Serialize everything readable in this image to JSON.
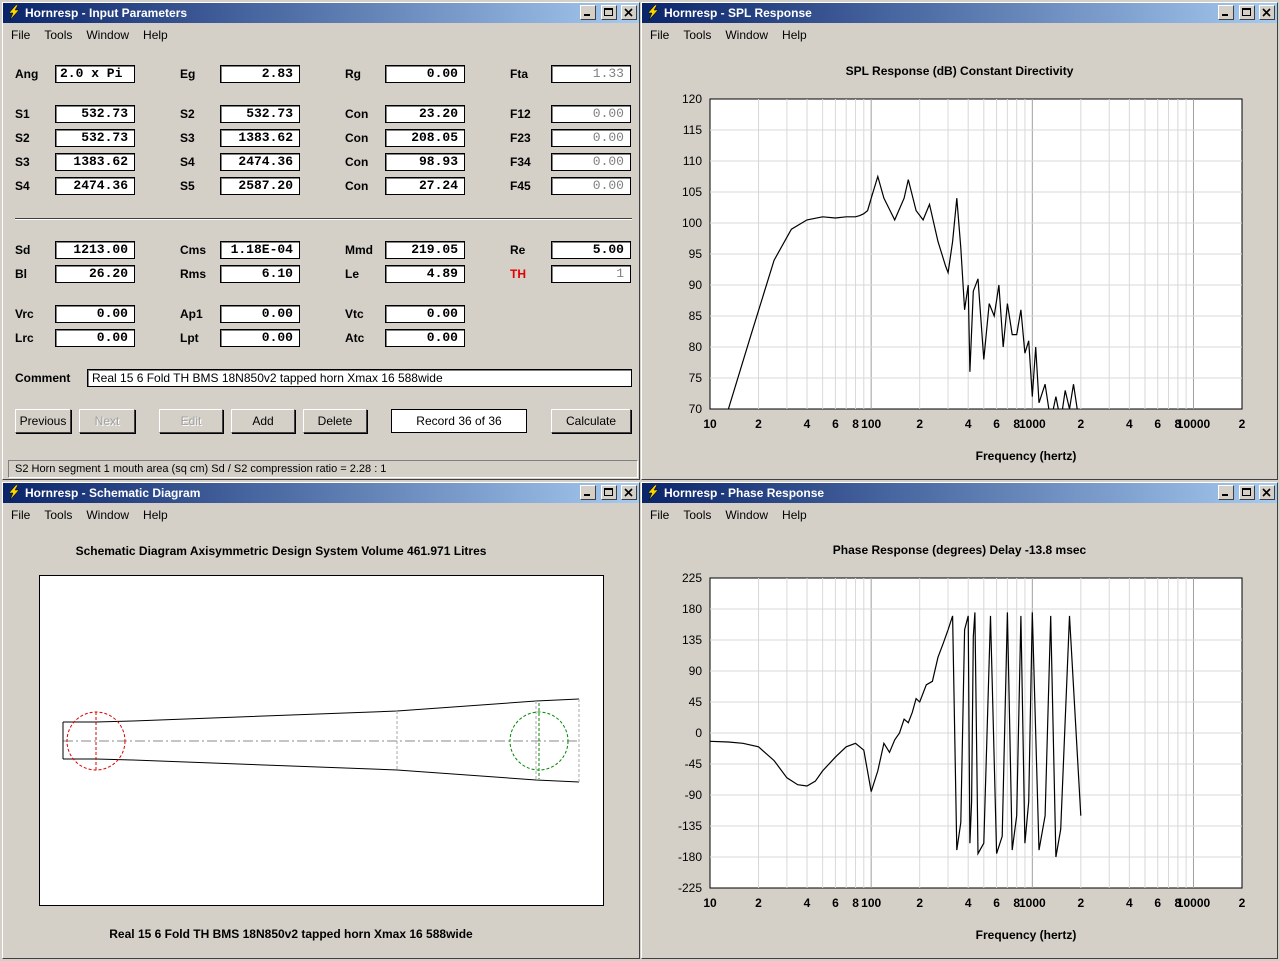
{
  "windows": {
    "input": {
      "title": "Hornresp - Input Parameters",
      "menu": [
        "File",
        "Tools",
        "Window",
        "Help"
      ],
      "rows1": [
        [
          {
            "l": "Ang",
            "v": "2.0 x Pi",
            "left": true
          },
          {
            "l": "Eg",
            "v": "2.83"
          },
          {
            "l": "Rg",
            "v": "0.00"
          },
          {
            "l": "Fta",
            "v": "1.33",
            "gray": true
          }
        ],
        [
          {
            "l": "S1",
            "v": "532.73"
          },
          {
            "l": "S2",
            "v": "532.73"
          },
          {
            "l": "Con",
            "v": "23.20"
          },
          {
            "l": "F12",
            "v": "0.00",
            "gray": true
          }
        ],
        [
          {
            "l": "S2",
            "v": "532.73"
          },
          {
            "l": "S3",
            "v": "1383.62"
          },
          {
            "l": "Con",
            "v": "208.05"
          },
          {
            "l": "F23",
            "v": "0.00",
            "gray": true
          }
        ],
        [
          {
            "l": "S3",
            "v": "1383.62"
          },
          {
            "l": "S4",
            "v": "2474.36"
          },
          {
            "l": "Con",
            "v": "98.93"
          },
          {
            "l": "F34",
            "v": "0.00",
            "gray": true
          }
        ],
        [
          {
            "l": "S4",
            "v": "2474.36"
          },
          {
            "l": "S5",
            "v": "2587.20"
          },
          {
            "l": "Con",
            "v": "27.24"
          },
          {
            "l": "F45",
            "v": "0.00",
            "gray": true
          }
        ]
      ],
      "rows2": [
        [
          {
            "l": "Sd",
            "v": "1213.00"
          },
          {
            "l": "Cms",
            "v": "1.18E-04"
          },
          {
            "l": "Mmd",
            "v": "219.05"
          },
          {
            "l": "Re",
            "v": "5.00"
          }
        ],
        [
          {
            "l": "Bl",
            "v": "26.20"
          },
          {
            "l": "Rms",
            "v": "6.10"
          },
          {
            "l": "Le",
            "v": "4.89"
          },
          {
            "l": "TH",
            "v": "1",
            "gray": true,
            "red": true
          }
        ],
        [
          {
            "l": "Vrc",
            "v": "0.00"
          },
          {
            "l": "Ap1",
            "v": "0.00"
          },
          {
            "l": "Vtc",
            "v": "0.00"
          }
        ],
        [
          {
            "l": "Lrc",
            "v": "0.00"
          },
          {
            "l": "Lpt",
            "v": "0.00"
          },
          {
            "l": "Atc",
            "v": "0.00"
          }
        ]
      ],
      "comment_label": "Comment",
      "comment": "Real 15 6 Fold TH BMS 18N850v2 tapped horn  Xmax 16 588wide",
      "buttons": {
        "previous": "Previous",
        "next": "Next",
        "edit": "Edit",
        "add": "Add",
        "delete": "Delete",
        "record": "Record 36 of 36",
        "calculate": "Calculate"
      },
      "status": "S2   Horn segment 1 mouth area  (sq cm)   Sd / S2 compression ratio = 2.28 : 1"
    },
    "spl": {
      "title": "Hornresp - SPL Response",
      "menu": [
        "File",
        "Tools",
        "Window",
        "Help"
      ],
      "chart_title": "SPL Response (dB)    Constant Directivity"
    },
    "schematic": {
      "title": "Hornresp - Schematic Diagram",
      "menu": [
        "File",
        "Tools",
        "Window",
        "Help"
      ],
      "heading": "Schematic Diagram    Axisymmetric Design    System Volume 461.971 Litres",
      "caption": "Real 15 6 Fold TH BMS 18N850v2 tapped horn  Xmax 16 588wide"
    },
    "phase": {
      "title": "Hornresp - Phase Response",
      "menu": [
        "File",
        "Tools",
        "Window",
        "Help"
      ],
      "chart_title": "Phase Response (degrees)    Delay -13.8 msec"
    }
  },
  "chart_data": [
    {
      "type": "line",
      "xscale": "log",
      "xlabel": "Frequency (hertz)",
      "ylabel": "",
      "ylim": [
        70,
        120
      ],
      "yticks": [
        70,
        75,
        80,
        85,
        90,
        95,
        100,
        105,
        110,
        115,
        120
      ],
      "xlim": [
        10,
        20000
      ],
      "xtick_labels": [
        "10",
        "2",
        "4",
        "6",
        "8",
        "100",
        "2",
        "4",
        "6",
        "8",
        "1000",
        "2",
        "4",
        "6",
        "8",
        "10000",
        "2"
      ],
      "series": [
        {
          "x": [
            10,
            13,
            18,
            25,
            32,
            40,
            50,
            60,
            70,
            80,
            85,
            90,
            95,
            100,
            110,
            120,
            140,
            160,
            170,
            190,
            210,
            230,
            260,
            290,
            300,
            320,
            340,
            360,
            380,
            400,
            410,
            430,
            460,
            500,
            540,
            580,
            620,
            660,
            700,
            750,
            800,
            850,
            900,
            950,
            1000,
            1050,
            1100,
            1200,
            1300,
            1400,
            1500,
            1600,
            1700,
            1800,
            1900,
            2000
          ],
          "y": [
            60,
            70,
            82,
            94,
            99,
            100.5,
            101,
            100.8,
            101,
            101,
            101.2,
            101.5,
            102,
            104,
            107.5,
            104,
            100.5,
            104,
            107,
            102,
            100.5,
            103,
            97,
            93,
            92,
            97,
            104,
            96,
            86,
            90,
            76,
            89,
            91,
            78,
            87,
            85,
            90,
            80,
            87,
            82,
            82,
            86,
            79,
            81,
            72,
            80,
            71,
            74,
            68,
            72,
            68,
            73,
            70,
            74,
            70,
            68
          ]
        }
      ],
      "grid": true
    },
    {
      "type": "line",
      "xscale": "log",
      "xlabel": "Frequency (hertz)",
      "ylabel": "",
      "ylim": [
        -225,
        225
      ],
      "yticks": [
        -225,
        -180,
        -135,
        -90,
        -45,
        0,
        45,
        90,
        135,
        180,
        225
      ],
      "xlim": [
        10,
        20000
      ],
      "xtick_labels": [
        "10",
        "2",
        "4",
        "6",
        "8",
        "100",
        "2",
        "4",
        "6",
        "8",
        "1000",
        "2",
        "4",
        "6",
        "8",
        "10000",
        "2"
      ],
      "series": [
        {
          "x": [
            10,
            13,
            16,
            20,
            25,
            30,
            35,
            40,
            45,
            50,
            60,
            70,
            80,
            90,
            100,
            110,
            120,
            130,
            140,
            150,
            160,
            170,
            180,
            190,
            200,
            220,
            240,
            260,
            280,
            300,
            320,
            340,
            360,
            380,
            400,
            410,
            420,
            430,
            440,
            460,
            500,
            550,
            600,
            650,
            700,
            750,
            800,
            850,
            900,
            950,
            1000,
            1100,
            1200,
            1300,
            1400,
            1500,
            1700,
            2000
          ],
          "y": [
            -12,
            -13,
            -15,
            -20,
            -40,
            -65,
            -75,
            -77,
            -70,
            -55,
            -35,
            -20,
            -15,
            -25,
            -85,
            -55,
            -15,
            -28,
            -10,
            0,
            20,
            15,
            30,
            50,
            45,
            70,
            75,
            110,
            130,
            150,
            170,
            -170,
            -130,
            150,
            170,
            -160,
            -100,
            140,
            175,
            -175,
            -160,
            170,
            -175,
            -150,
            175,
            -170,
            -120,
            170,
            -160,
            -100,
            175,
            -170,
            -120,
            170,
            -180,
            -140,
            170,
            -120
          ]
        }
      ],
      "grid": true
    }
  ]
}
